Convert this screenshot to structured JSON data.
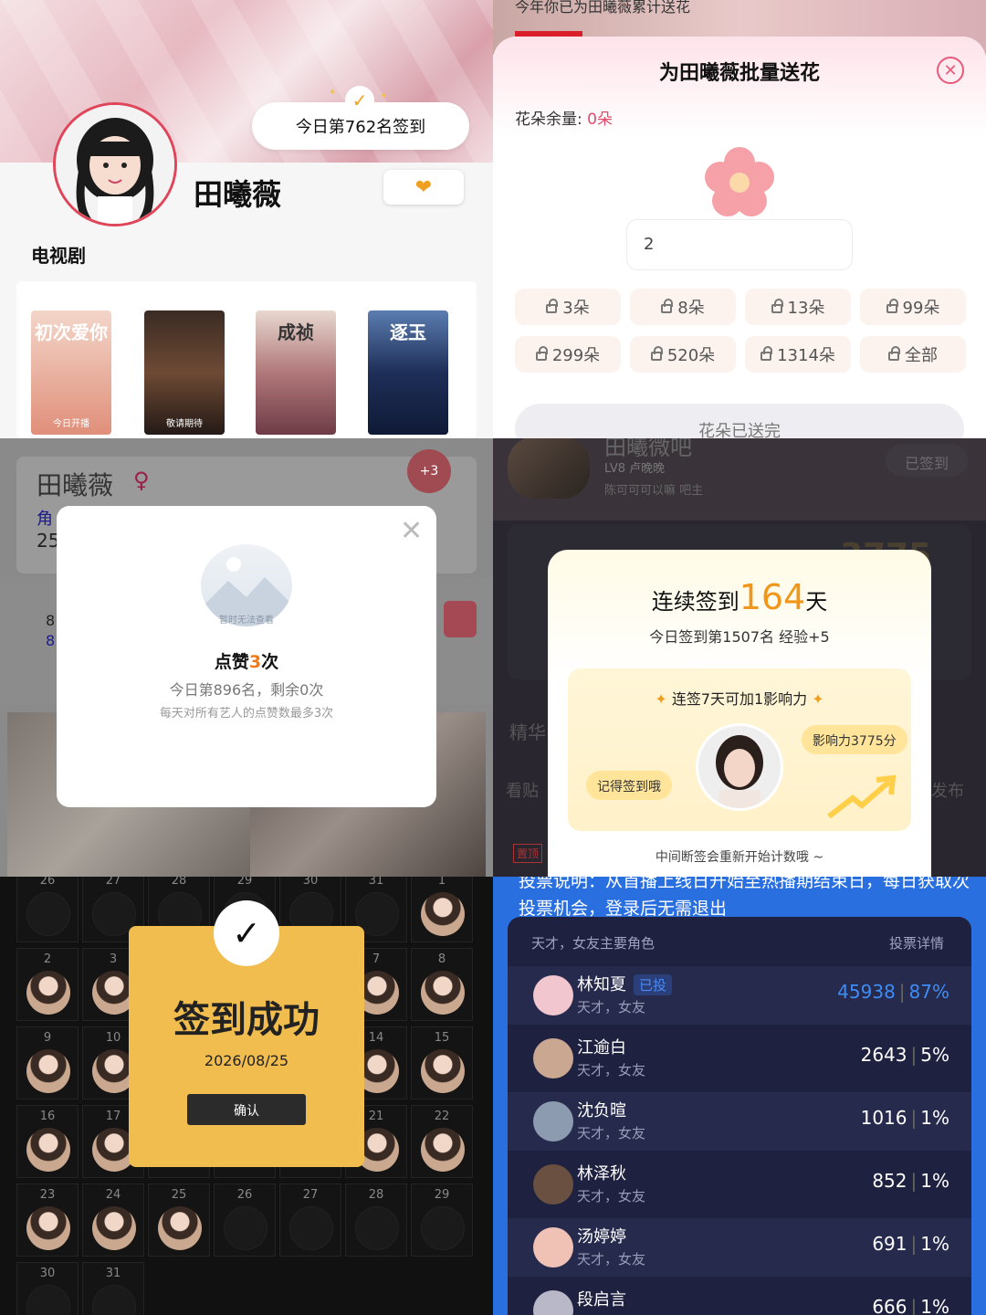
{
  "p1": {
    "checkin": "今日第762名签到",
    "name": "田曦薇",
    "section": "电视剧",
    "posters": [
      {
        "title": "初次爱你",
        "foot": "今日开播"
      },
      {
        "title": "",
        "foot": "敬请期待"
      },
      {
        "title": "成祯",
        "foot": ""
      },
      {
        "title": "逐玉",
        "foot": ""
      }
    ]
  },
  "p2": {
    "top_text": "今年你已为田曦薇累计送花",
    "title": "为田曦薇批量送花",
    "remain_label": "花朵余量:",
    "remain_value": "0朵",
    "qty_value": "2",
    "chips": [
      "3朵",
      "8朵",
      "13朵",
      "99朵",
      "299朵",
      "520朵",
      "1314朵",
      "全部"
    ],
    "sent_label": "花朵已送完"
  },
  "p3": {
    "bg_name": "田曦薇",
    "bg_role": "角",
    "bg_num": "25",
    "heart_badge": "+3",
    "bg_n1": "8",
    "bg_n2": "8",
    "image_text": "暂时无法查看",
    "like_prefix": "点赞",
    "like_count": "3",
    "like_suffix": "次",
    "like_sub": "今日第896名，剩余0次",
    "like_note": "每天对所有艺人的点赞数最多3次"
  },
  "p4": {
    "bg_user": "田曦微吧",
    "bg_lv": "LV8 卢晚晚",
    "bg_fan": "陈可可可以嘛  吧主",
    "bg_signed": "已签到",
    "bg_score": "3775",
    "bg_jing": "精华",
    "bg_kan": "看贴",
    "bg_fabu": "发布",
    "bg_top": "置顶",
    "title_prefix": "连续签到",
    "days": "164",
    "title_suffix": "天",
    "sub": "今日签到第1507名 经验+5",
    "box_title": "连签7天可加1影响力",
    "bubble_left": "记得签到哦",
    "bubble_right": "影响力3775分",
    "foot": "中间断签会重新开始计数哦 ~"
  },
  "p5": {
    "top_days": [
      "26",
      "27",
      "28",
      "29",
      "30",
      "31",
      "1"
    ],
    "rows": [
      [
        "2",
        "3",
        "",
        "",
        "",
        "7",
        "8"
      ],
      [
        "9",
        "10",
        "",
        "",
        "",
        "14",
        "15"
      ],
      [
        "16",
        "17",
        "",
        "",
        "",
        "21",
        "22"
      ],
      [
        "23",
        "24",
        "25",
        "26",
        "27",
        "28",
        "29"
      ],
      [
        "30",
        "31"
      ]
    ],
    "title": "签到成功",
    "date": "2026/08/25",
    "confirm": "确认"
  },
  "p6": {
    "hint": "投票说明：从首播上线日开始至热播期结束日，每日获取次投票机会，登录后无需退出",
    "header_left": "天才，女友主要角色",
    "header_right": "投票详情",
    "voted_tag": "已投",
    "rows": [
      {
        "name": "林知夏",
        "tags": "天才，女友",
        "votes": "45938",
        "pct": "87%"
      },
      {
        "name": "江逾白",
        "tags": "天才，女友",
        "votes": "2643",
        "pct": "5%"
      },
      {
        "name": "沈负暄",
        "tags": "天才，女友",
        "votes": "1016",
        "pct": "1%"
      },
      {
        "name": "林泽秋",
        "tags": "天才，女友",
        "votes": "852",
        "pct": "1%"
      },
      {
        "name": "汤婷婷",
        "tags": "天才，女友",
        "votes": "691",
        "pct": "1%"
      },
      {
        "name": "段启言",
        "tags": "",
        "votes": "666",
        "pct": "1%"
      }
    ]
  }
}
